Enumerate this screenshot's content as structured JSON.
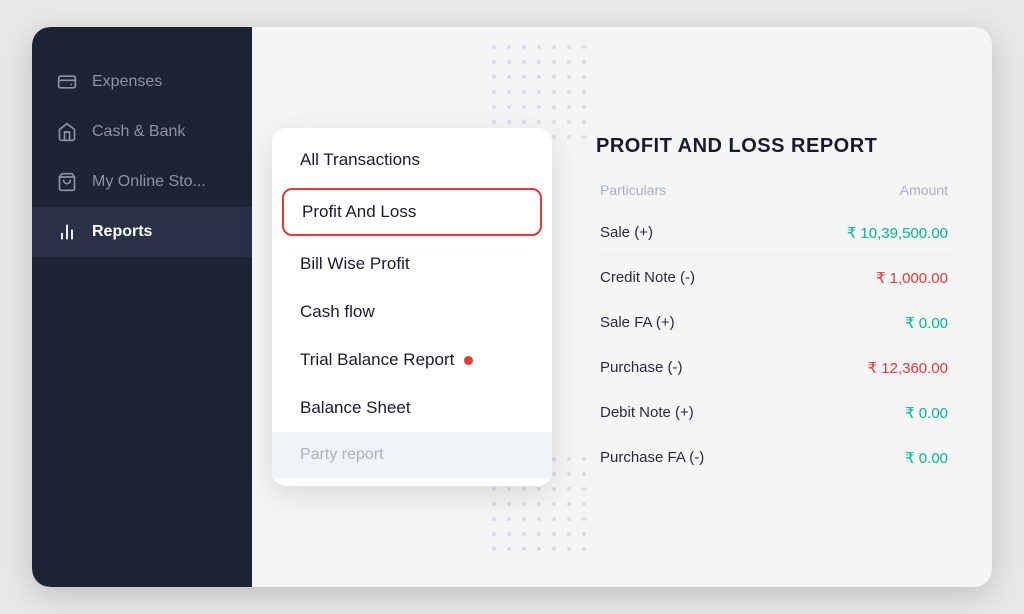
{
  "sidebar": {
    "items": [
      {
        "id": "expenses",
        "label": "Expenses",
        "icon": "wallet"
      },
      {
        "id": "cash-bank",
        "label": "Cash & Bank",
        "icon": "bank"
      },
      {
        "id": "online-store",
        "label": "My Online Sto...",
        "icon": "store"
      },
      {
        "id": "reports",
        "label": "Reports",
        "icon": "bar-chart",
        "active": true
      }
    ]
  },
  "dropdown": {
    "items": [
      {
        "id": "all-transactions",
        "label": "All Transactions",
        "selected": false,
        "grayed": false,
        "badge": false
      },
      {
        "id": "profit-and-loss",
        "label": "Profit And Loss",
        "selected": true,
        "grayed": false,
        "badge": false
      },
      {
        "id": "bill-wise-profit",
        "label": "Bill Wise Profit",
        "selected": false,
        "grayed": false,
        "badge": false
      },
      {
        "id": "cash-flow",
        "label": "Cash flow",
        "selected": false,
        "grayed": false,
        "badge": false
      },
      {
        "id": "trial-balance",
        "label": "Trial Balance Report",
        "selected": false,
        "grayed": false,
        "badge": true
      },
      {
        "id": "balance-sheet",
        "label": "Balance Sheet",
        "selected": false,
        "grayed": false,
        "badge": false
      },
      {
        "id": "party-report",
        "label": "Party report",
        "selected": false,
        "grayed": true,
        "badge": false
      }
    ]
  },
  "report": {
    "title": "PROFIT AND LOSS REPORT",
    "columns": {
      "particulars": "Particulars",
      "amount": "Amount"
    },
    "rows": [
      {
        "particular": "Sale (+)",
        "amount": "₹ 10,39,500.00",
        "color": "green"
      },
      {
        "particular": "Credit Note (-)",
        "amount": "₹ 1,000.00",
        "color": "red"
      },
      {
        "particular": "Sale FA (+)",
        "amount": "₹ 0.00",
        "color": "green"
      },
      {
        "particular": "Purchase (-)",
        "amount": "₹ 12,360.00",
        "color": "red"
      },
      {
        "particular": "Debit Note (+)",
        "amount": "₹ 0.00",
        "color": "green"
      },
      {
        "particular": "Purchase FA (-)",
        "amount": "₹ 0.00",
        "color": "green"
      }
    ]
  }
}
